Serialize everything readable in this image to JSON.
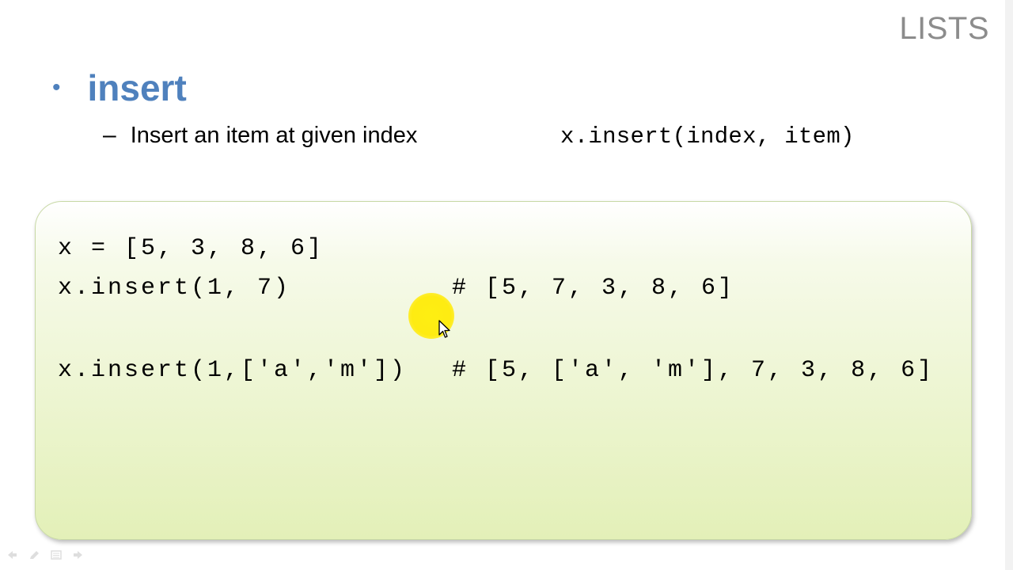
{
  "slide": {
    "corner_title": "LISTS",
    "heading": "insert",
    "subpoint": "Insert an item at given index",
    "syntax": "x.insert(index, item)"
  },
  "code": {
    "lines": [
      {
        "code": "x = [5, 3, 8, 6]",
        "comment": ""
      },
      {
        "code": "x.insert(1, 7)",
        "comment": "# [5, 7, 3, 8, 6]"
      },
      {
        "code": "x.insert(1,['a','m'])",
        "comment": "# [5, ['a', 'm'], 7, 3, 8, 6]"
      }
    ]
  },
  "colors": {
    "accent": "#4f81bd",
    "box_gradient_end": "#e3f0b8",
    "pointer": "#ffee00"
  },
  "icons": {
    "cursor": "arrow-cursor-icon",
    "pointer": "laser-pointer-highlight"
  }
}
